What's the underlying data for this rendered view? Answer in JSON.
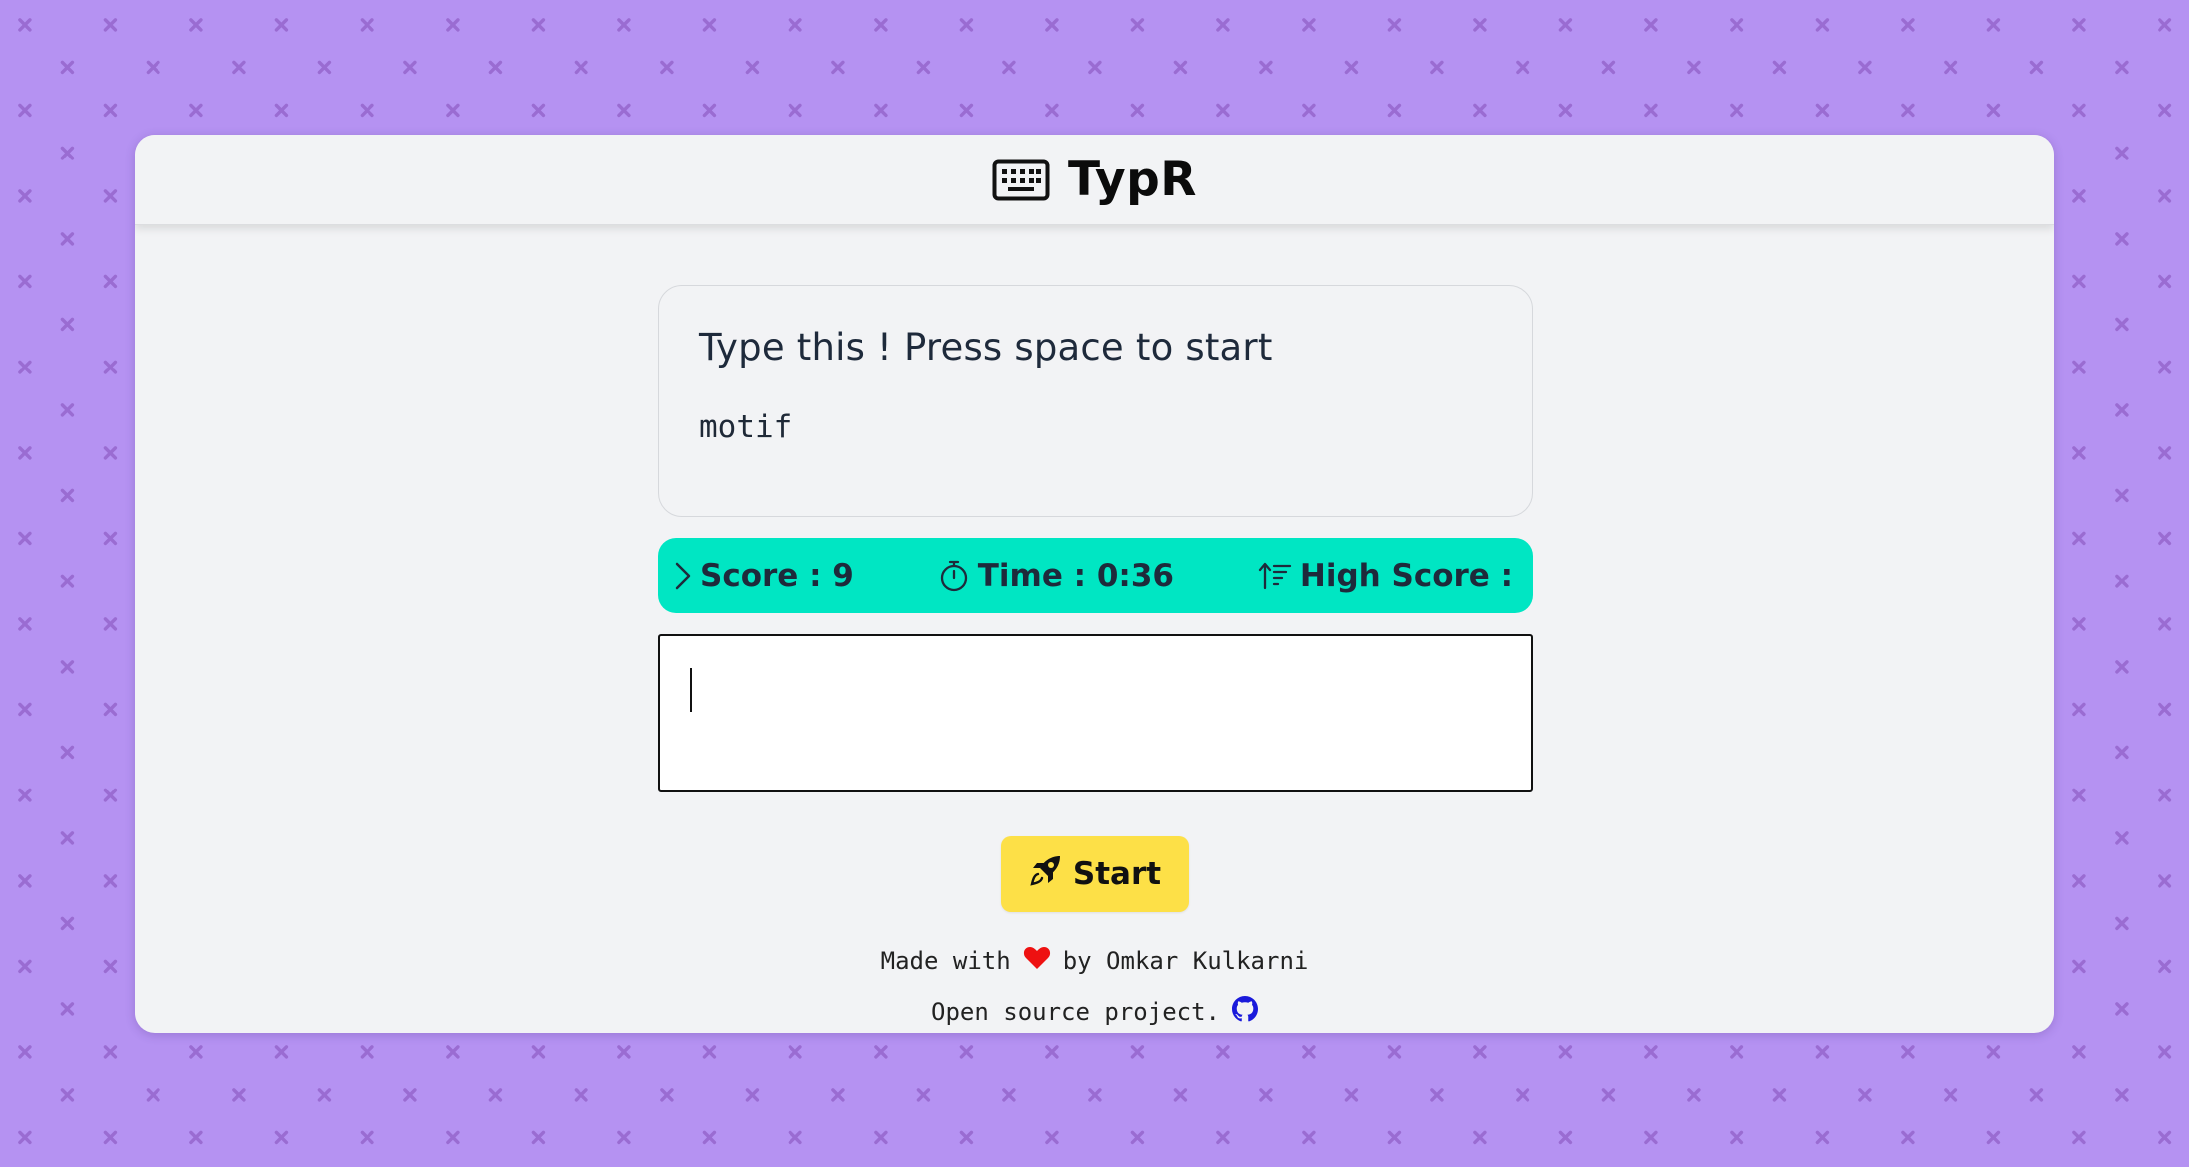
{
  "header": {
    "logo_icon": "keyboard-icon",
    "title": "TypR"
  },
  "prompt": {
    "heading": "Type this ! Press space to start",
    "word": "motif"
  },
  "stats": {
    "score_icon": "chevron-right-icon",
    "score_label": "Score : 9",
    "time_icon": "stopwatch-icon",
    "time_label": "Time : 0:36",
    "high_score_icon": "sort-ascending-icon",
    "high_score_label": "High Score :"
  },
  "input": {
    "value": "",
    "placeholder": ""
  },
  "start_button": {
    "icon": "rocket-icon",
    "label": "Start"
  },
  "footer": {
    "made_with": "Made with",
    "heart_icon": "heart-icon",
    "by_author": "by Omkar Kulkarni",
    "open_source": "Open source project.",
    "github_icon": "github-icon"
  },
  "colors": {
    "page_background": "#b592f2",
    "pattern": "#9a6cd2",
    "card_background": "#f2f3f5",
    "stats_bar": "#00e6c3",
    "start_button": "#fde047",
    "heart": "#ee1111",
    "github": "#1a1adb"
  }
}
